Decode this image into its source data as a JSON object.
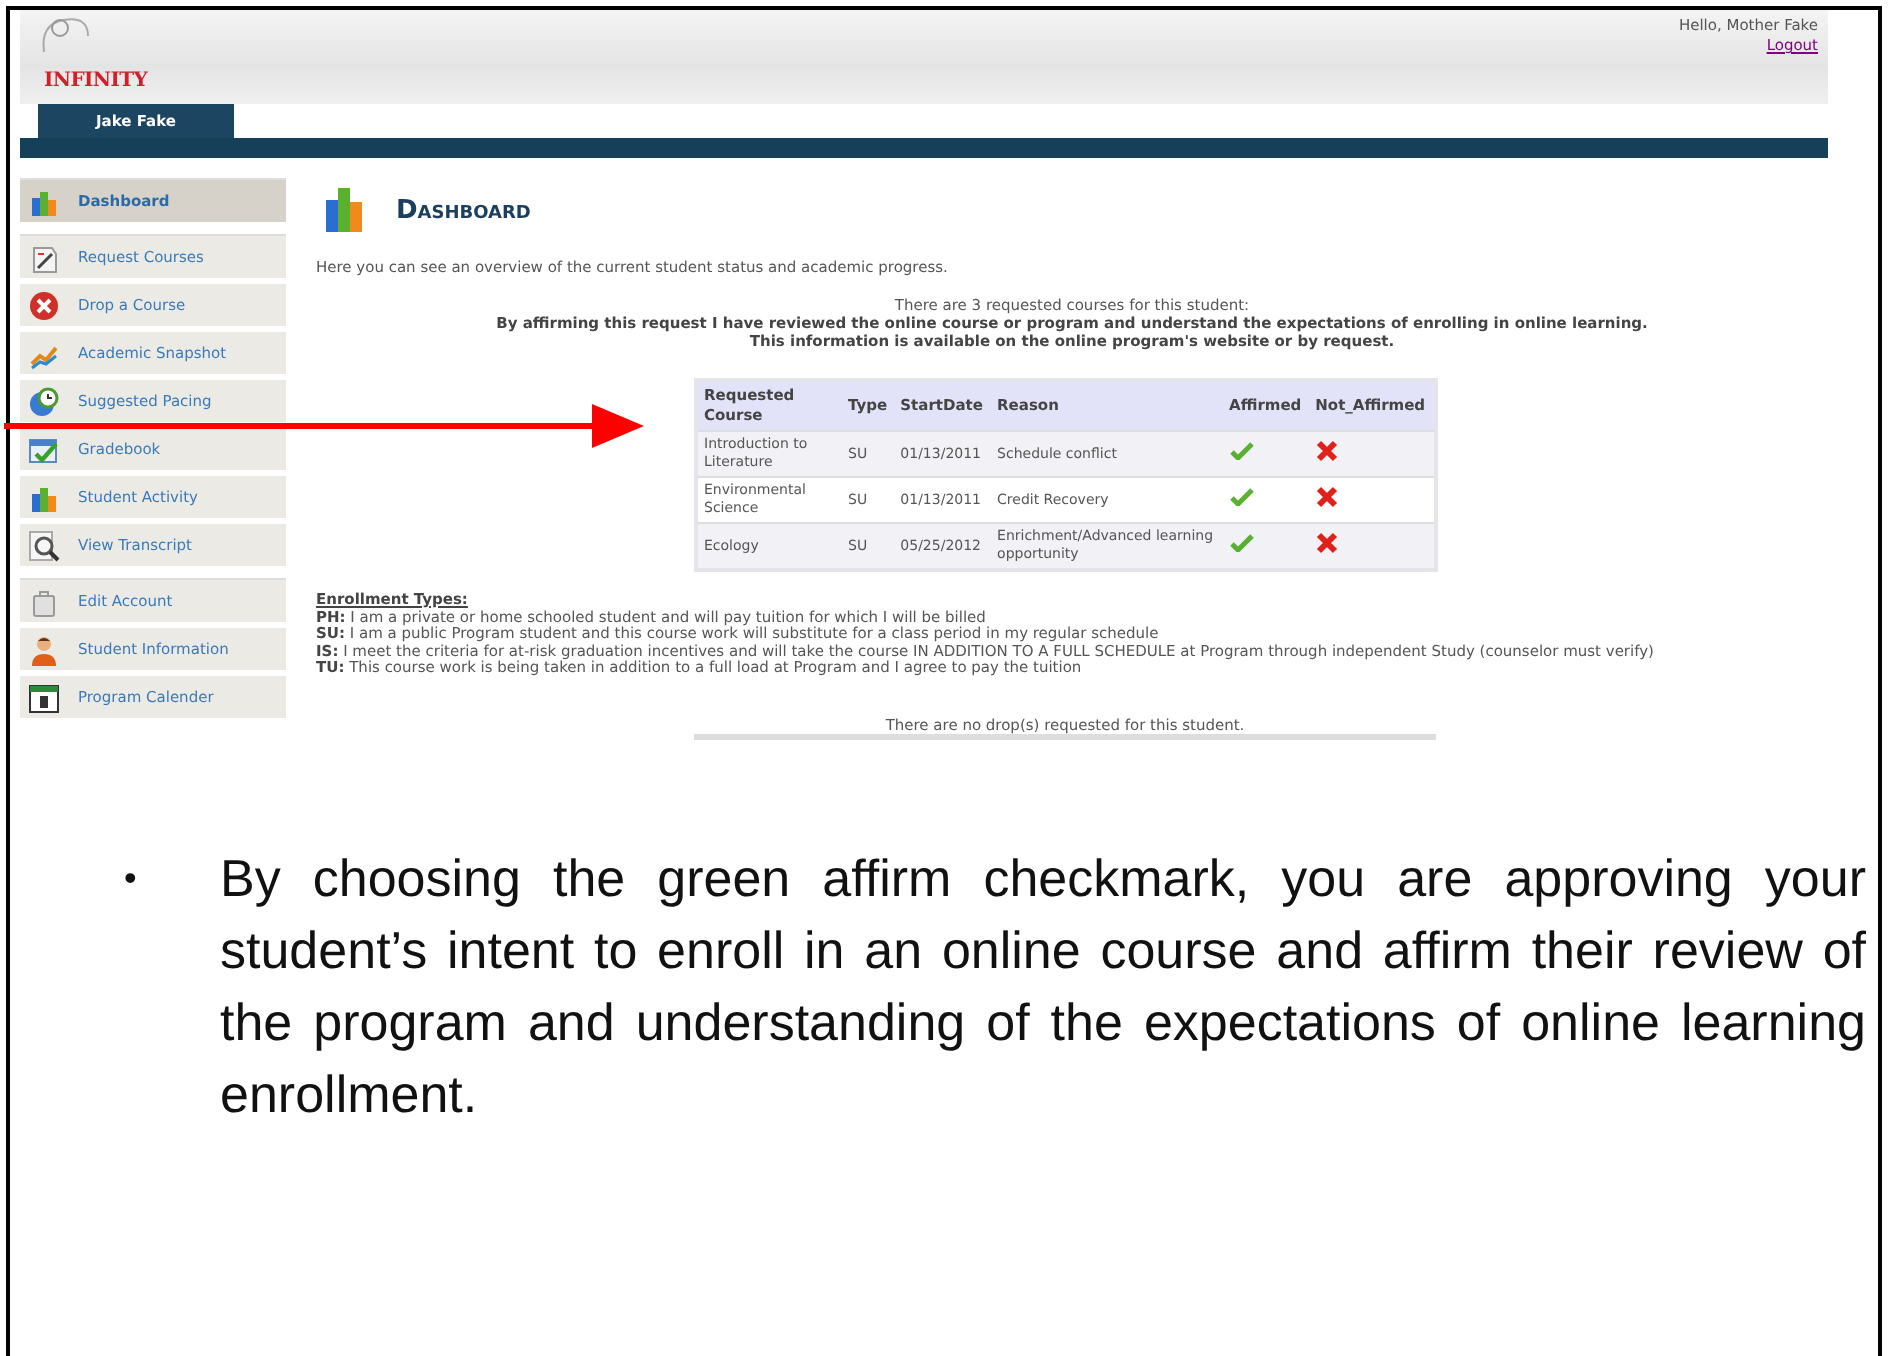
{
  "header": {
    "logo_text": "INFINITY",
    "greeting": "Hello, Mother Fake",
    "logout_link": "Logout"
  },
  "student_tabs": [
    {
      "label": "Jake Fake",
      "selected": true
    }
  ],
  "sidebar": {
    "groups": [
      {
        "items": [
          {
            "label": "Dashboard",
            "selected": true
          }
        ]
      },
      {
        "items": [
          {
            "label": "Request Courses",
            "selected": false
          },
          {
            "label": "Drop a Course",
            "selected": false
          },
          {
            "label": "Academic Snapshot",
            "selected": false
          },
          {
            "label": "Suggested Pacing",
            "selected": false
          },
          {
            "label": "Gradebook",
            "selected": false
          },
          {
            "label": "Student Activity",
            "selected": false
          },
          {
            "label": "View Transcript",
            "selected": false
          }
        ]
      },
      {
        "items": [
          {
            "label": "Edit Account",
            "selected": false
          },
          {
            "label": "Student Information",
            "selected": false
          },
          {
            "label": "Program Calender",
            "selected": false
          }
        ]
      }
    ]
  },
  "page": {
    "title": "Dashboard",
    "intro": "Here you can see an overview of the current student status and academic progress.",
    "request_summary": "There are 3 requested courses for this student:",
    "affirm_notice": [
      "By affirming this request I have reviewed the online course or program and understand the expectations of enrolling in online learning.",
      "This information is available on the online program's website or by request."
    ],
    "table": {
      "columns": [
        "Requested Course",
        "Type",
        "StartDate",
        "Reason",
        "Affirmed",
        "Not_Affirmed"
      ],
      "rows": [
        {
          "course": "Introduction to Literature",
          "type": "SU",
          "start_date": "01/13/2011",
          "reason": "Schedule conflict"
        },
        {
          "course": "Environmental Science",
          "type": "SU",
          "start_date": "01/13/2011",
          "reason": "Credit Recovery"
        },
        {
          "course": "Ecology",
          "type": "SU",
          "start_date": "05/25/2012",
          "reason": "Enrichment/Advanced learning opportunity"
        }
      ]
    },
    "enrollment_types": {
      "heading": "Enrollment Types:",
      "items": [
        "**PH:** I am a private or home schooled student and will pay tuition for which I will be billed",
        "**SU:** I am a public Program student and this course work will substitute for a class period in my regular schedule",
        "**IS:** I meet the criteria for at-risk graduation incentives and will take the course IN ADDITION TO A FULL SCHEDULE at Program through independent Study (counselor must verify)",
        "**TU:** This course work is being taken in addition to a full load at Program and I agree to pay the tuition"
      ]
    },
    "drops_message": "There are no drop(s) requested for this student."
  },
  "document": {
    "bullets": [
      {
        "marker": "•",
        "text": "By choosing the green affirm checkmark, you are approving your student’s intent to enroll in an online course and affirm their review of the program and understanding of the expectations of online learning enrollment."
      }
    ]
  }
}
